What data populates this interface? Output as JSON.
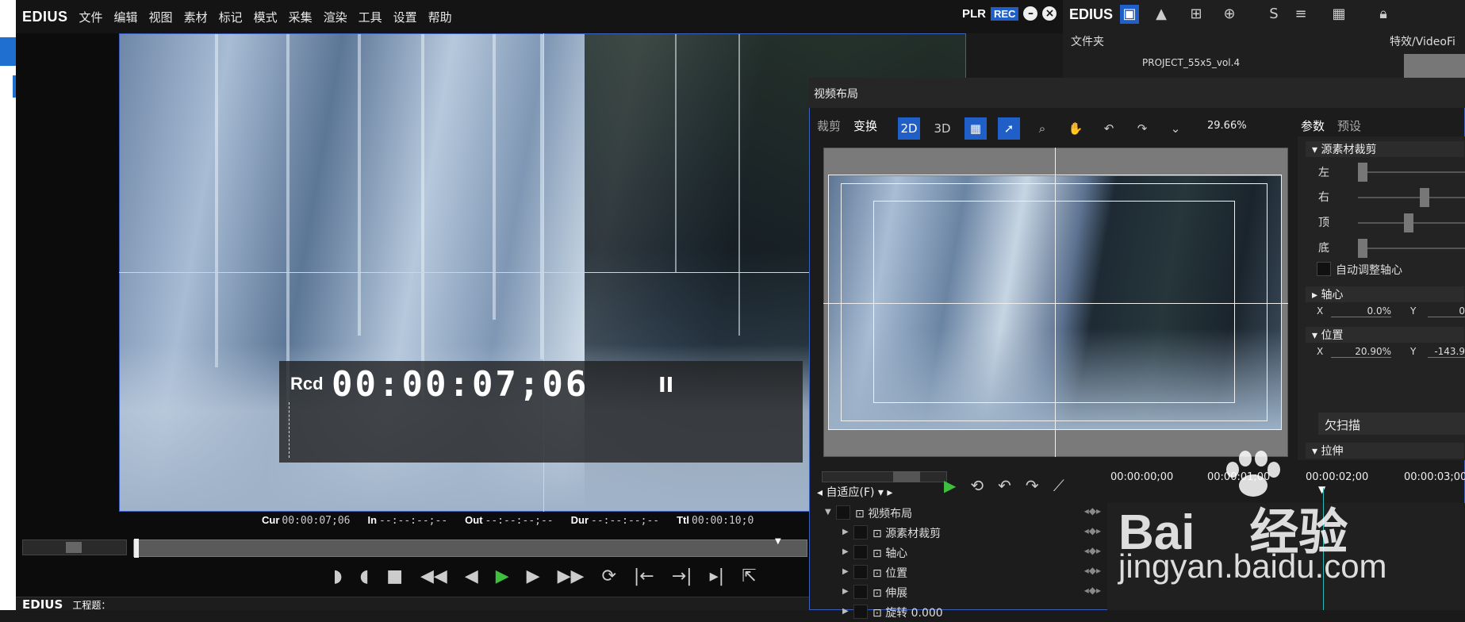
{
  "app": {
    "logo": "EDIUS"
  },
  "menu": [
    "文件",
    "编辑",
    "视图",
    "素材",
    "标记",
    "模式",
    "采集",
    "渲染",
    "工具",
    "设置",
    "帮助"
  ],
  "rec": {
    "plr": "PLR",
    "rec": "REC"
  },
  "player": {
    "rcd_label": "Rcd",
    "timecode": "00:00:07;06",
    "pause_glyph": "II",
    "info": {
      "cur_label": "Cur",
      "cur": "00:00:07;06",
      "in_label": "In",
      "in": "--:--:--;--",
      "out_label": "Out",
      "out": "--:--:--;--",
      "dur_label": "Dur",
      "dur": "--:--:--;--",
      "ttl_label": "Ttl",
      "ttl": "00:00:10;0"
    },
    "bottom_logo": "EDIUS",
    "bottom_label": "工程题："
  },
  "project": {
    "logo": "EDIUS",
    "folder_title": "文件夹",
    "effects_title": "特效/VideoFi",
    "project_name": "PROJECT_55x5_vol.4"
  },
  "dialog": {
    "title": "视频布局",
    "tabs": [
      "裁剪",
      "变换"
    ],
    "tool_2d": "2D",
    "tool_3d": "3D",
    "zoom": "29.66%",
    "param_tabs": [
      "参数",
      "预设"
    ],
    "params": {
      "crop_section": "源素材裁剪",
      "left": "左",
      "right": "右",
      "top": "顶",
      "bottom": "底",
      "auto_center": "自动调整轴心",
      "pivot_section": "轴心",
      "pivot_x_label": "X",
      "pivot_x": "0.0%",
      "pivot_y_label": "Y",
      "pivot_y": "0",
      "pos_section": "位置",
      "pos_x_label": "X",
      "pos_x": "20.90%",
      "pos_y_label": "Y",
      "pos_y": "-143.9",
      "underscan": "欠扫描",
      "stretch_section": "拉伸"
    },
    "fit": "自适应(F)",
    "ruler": [
      "00:00:00;00",
      "00:00:01;00",
      "00:00:02;00",
      "00:00:03;00"
    ],
    "tracks": [
      "视频布局",
      "源素材裁剪",
      "轴心",
      "位置",
      "伸展",
      "旋转 0.000"
    ]
  },
  "watermark": {
    "line1": "Bai",
    "line2": "经验",
    "line3": "jingyan.baidu.com"
  }
}
